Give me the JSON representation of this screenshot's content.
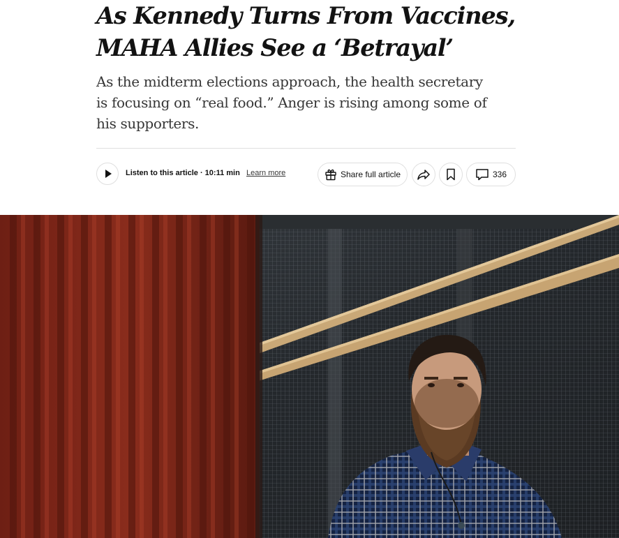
{
  "article": {
    "headline_line1": "As Kennedy Turns From Vaccines,",
    "headline_line2": "MAHA Allies See a ‘Betrayal’",
    "summary": "As the midterm elections approach, the health secretary is focusing on “real food.” Anger is rising among some of his supporters."
  },
  "toolbar": {
    "listen_label": "Listen to this article · 10:11 min",
    "learn_more": "Learn more",
    "share_label": "Share full article",
    "comment_count": "336",
    "icons": [
      "play-icon",
      "gift-icon",
      "forward-share-icon",
      "bookmark-icon",
      "comment-icon"
    ]
  },
  "photo": {
    "subject": "bearded man in blue plaid shirt leaning against wire-mesh wall beside red corrugated metal"
  },
  "colors": {
    "text": "#121212",
    "summary_text": "#363636",
    "border": "#dfdfdf",
    "red_metal": "#7a2618",
    "mesh_dark": "#2b2f33",
    "wood": "#c9a877"
  }
}
